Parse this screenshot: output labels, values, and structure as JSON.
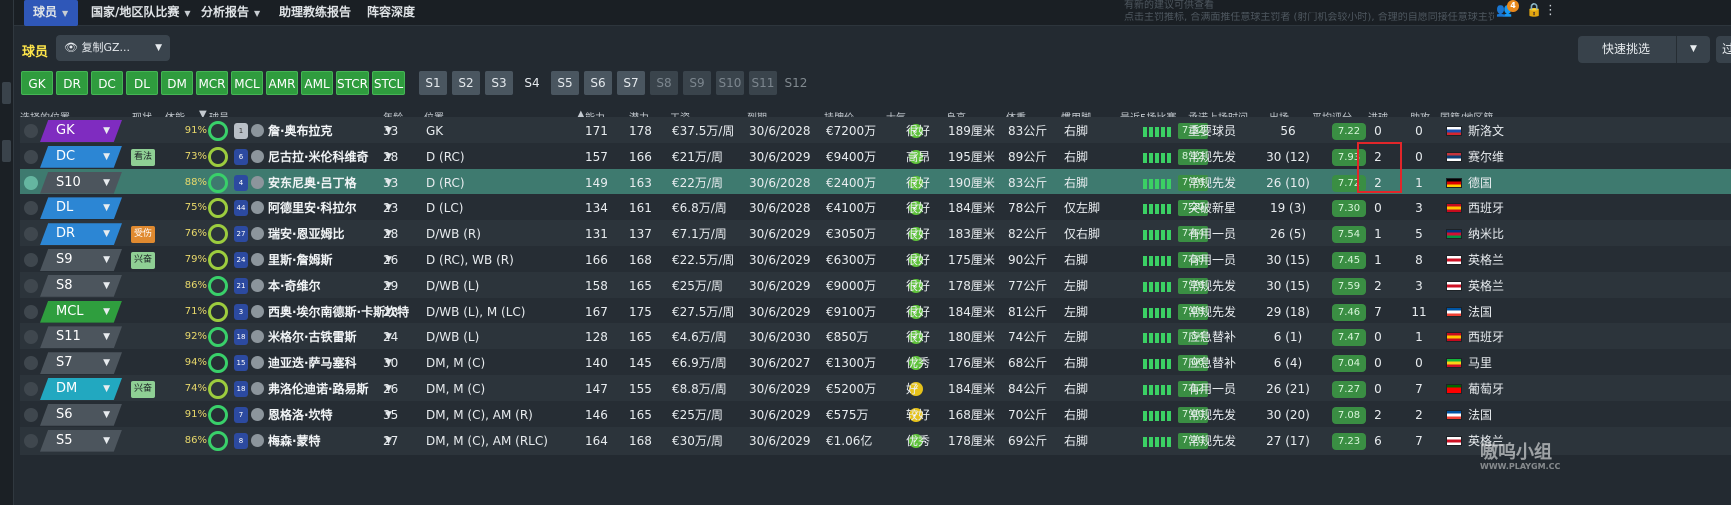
{
  "topnav": {
    "items": [
      {
        "label": "球员",
        "active": true
      },
      {
        "label": "国家/地区队比赛",
        "active": false
      },
      {
        "label": "分析报告",
        "active": false
      },
      {
        "label": "助理教练报告",
        "active": false
      },
      {
        "label": "阵容深度",
        "active": false
      }
    ],
    "hint_line1": "有新的建议可供查看",
    "hint_line2": "点击主罚推标, 合满面推任意球主罚者 (射门机会较小时), 合理的自愿同接任意球主罚者",
    "notification_count": "4"
  },
  "toolbar": {
    "section_title": "球员",
    "view_select": "复制GZ...",
    "quick_pick": "快速挑选",
    "filter": "过滤"
  },
  "position_filters": {
    "green": [
      "GK",
      "DR",
      "DC",
      "DL",
      "DM",
      "MCR",
      "MCL",
      "AMR",
      "AML",
      "STCR",
      "STCL"
    ],
    "subs": [
      "S1",
      "S2",
      "S3",
      "S4",
      "S5",
      "S6",
      "S7",
      "S8",
      "S9",
      "S10",
      "S11",
      "S12"
    ]
  },
  "columns": {
    "sel_position": "选择的位置",
    "status": "现状",
    "fitness": "体能...",
    "player": "球员",
    "age": "年龄",
    "position": "位置",
    "ability": "能力",
    "potential": "潜力",
    "wage": "工资",
    "expires": "到期",
    "value": "挂牌价",
    "morale": "士气",
    "height": "身高",
    "weight": "体重",
    "foot": "惯用脚",
    "last5": "最近5场比赛",
    "role": "承诺上场时间",
    "apps": "出场",
    "avg_rating": "平均评分",
    "goals": "进球",
    "assists": "助攻",
    "nation": "国籍/地区籍"
  },
  "rows": [
    {
      "pos": "GK",
      "pos_type": "GK",
      "tag": "",
      "fit": "91%",
      "ring": "g",
      "shirt": "1",
      "gk": true,
      "name": "詹·奥布拉克",
      "age": "33",
      "position": "GK",
      "ca": "171",
      "pa": "178",
      "wage": "€37.5万/周",
      "expires": "30/6/2028",
      "value": "€7200万",
      "morale": "很好",
      "morale_c": "g",
      "height": "189厘米",
      "weight": "83公斤",
      "foot": "右脚",
      "last": "7.32",
      "role": "重要球员",
      "apps": "56",
      "avg": "7.22",
      "goals": "0",
      "assists": "0",
      "nation": "斯洛文",
      "flag": [
        "#ffffff",
        "#1c4fb0",
        "#d7262d"
      ],
      "form": [
        4,
        4,
        4,
        4,
        4
      ]
    },
    {
      "pos": "DC",
      "pos_type": "D",
      "tag": "看法",
      "tag_c": "green",
      "fit": "73%",
      "ring": "y",
      "shirt": "6",
      "name": "尼古拉·米伦科维奇",
      "age": "28",
      "position": "D (RC)",
      "ca": "157",
      "pa": "166",
      "wage": "€21万/周",
      "expires": "30/6/2029",
      "value": "€9400万",
      "morale": "高昂",
      "morale_c": "g",
      "height": "195厘米",
      "weight": "89公斤",
      "foot": "右脚",
      "last": "8.12",
      "role": "常规先发",
      "apps": "30 (12)",
      "avg": "7.93",
      "goals": "2",
      "assists": "0",
      "nation": "赛尔维",
      "flag": [
        "#c6363c",
        "#0c4076",
        "#ffffff"
      ],
      "form": [
        4,
        4,
        4,
        4,
        4
      ]
    },
    {
      "pos": "S10",
      "pos_type": "sub",
      "tag": "",
      "fit": "88%",
      "ring": "g",
      "shirt": "4",
      "name": "安东尼奥·吕丁格",
      "age": "33",
      "position": "D (RC)",
      "ca": "149",
      "pa": "163",
      "wage": "€22万/周",
      "expires": "30/6/2028",
      "value": "€2400万",
      "morale": "很好",
      "morale_c": "g",
      "height": "190厘米",
      "weight": "83公斤",
      "foot": "右脚",
      "last": "7.76",
      "role": "常规先发",
      "apps": "26 (10)",
      "avg": "7.72",
      "goals": "2",
      "assists": "1",
      "nation": "德国",
      "flag": [
        "#000000",
        "#dd0000",
        "#ffce00"
      ],
      "form": [
        4,
        4,
        4,
        4,
        4
      ],
      "selected": true
    },
    {
      "pos": "DL",
      "pos_type": "D",
      "tag": "",
      "fit": "75%",
      "ring": "y",
      "shirt": "44",
      "name": "阿德里安·科拉尔",
      "age": "23",
      "position": "D (LC)",
      "ca": "134",
      "pa": "161",
      "wage": "€6.8万/周",
      "expires": "30/6/2028",
      "value": "€4100万",
      "morale": "很好",
      "morale_c": "g",
      "height": "184厘米",
      "weight": "78公斤",
      "foot": "仅左脚",
      "last": "7.20",
      "role": "突破新星",
      "apps": "19 (3)",
      "avg": "7.30",
      "goals": "0",
      "assists": "3",
      "nation": "西班牙",
      "flag": [
        "#c60b1e",
        "#ffc400",
        "#c60b1e"
      ],
      "form": [
        4,
        4,
        4,
        4,
        4
      ]
    },
    {
      "pos": "DR",
      "pos_type": "D",
      "tag": "受伤",
      "tag_c": "orange",
      "fit": "76%",
      "ring": "y",
      "shirt": "27",
      "name": "瑞安·恩亚姆比",
      "age": "28",
      "position": "D/WB (R)",
      "ca": "131",
      "pa": "137",
      "wage": "€7.1万/周",
      "expires": "30/6/2029",
      "value": "€3050万",
      "morale": "很好",
      "morale_c": "g",
      "height": "183厘米",
      "weight": "82公斤",
      "foot": "仅右脚",
      "last": "7.44",
      "role": "有用一员",
      "apps": "26 (5)",
      "avg": "7.54",
      "goals": "1",
      "assists": "5",
      "nation": "纳米比",
      "flag": [
        "#003580",
        "#d21034",
        "#009543"
      ],
      "form": [
        4,
        4,
        4,
        4,
        4
      ]
    },
    {
      "pos": "S9",
      "pos_type": "sub",
      "tag": "兴奋",
      "tag_c": "green",
      "fit": "79%",
      "ring": "y",
      "shirt": "24",
      "name": "里斯·詹姆斯",
      "age": "26",
      "position": "D (RC), WB (R)",
      "ca": "166",
      "pa": "168",
      "wage": "€22.5万/周",
      "expires": "30/6/2029",
      "value": "€6300万",
      "morale": "很好",
      "morale_c": "g",
      "height": "175厘米",
      "weight": "90公斤",
      "foot": "右脚",
      "last": "7.38",
      "role": "有用一员",
      "apps": "30 (15)",
      "avg": "7.45",
      "goals": "1",
      "assists": "8",
      "nation": "英格兰",
      "flag": [
        "#ffffff",
        "#ce1124",
        "#ffffff"
      ],
      "form": [
        4,
        4,
        4,
        4,
        4
      ]
    },
    {
      "pos": "S8",
      "pos_type": "sub",
      "tag": "",
      "fit": "86%",
      "ring": "g",
      "shirt": "21",
      "name": "本·奇维尔",
      "age": "29",
      "position": "D/WB (L)",
      "ca": "158",
      "pa": "165",
      "wage": "€25万/周",
      "expires": "30/6/2029",
      "value": "€9000万",
      "morale": "很好",
      "morale_c": "g",
      "height": "178厘米",
      "weight": "77公斤",
      "foot": "左脚",
      "last": "7.76",
      "role": "常规先发",
      "apps": "30 (15)",
      "avg": "7.59",
      "goals": "2",
      "assists": "3",
      "nation": "英格兰",
      "flag": [
        "#ffffff",
        "#ce1124",
        "#ffffff"
      ],
      "form": [
        4,
        4,
        4,
        4,
        4
      ]
    },
    {
      "pos": "MCL",
      "pos_type": "M",
      "tag": "",
      "fit": "71%",
      "ring": "y",
      "shirt": "3",
      "name": "西奥·埃尔南德斯·卡斯坎特",
      "age": "28",
      "position": "D/WB (L), M (LC)",
      "ca": "167",
      "pa": "175",
      "wage": "€27.5万/周",
      "expires": "30/6/2029",
      "value": "€9100万",
      "morale": "很好",
      "morale_c": "g",
      "height": "184厘米",
      "weight": "81公斤",
      "foot": "左脚",
      "last": "7.08",
      "role": "常规先发",
      "apps": "29 (18)",
      "avg": "7.46",
      "goals": "7",
      "assists": "11",
      "nation": "法国",
      "flag": [
        "#0055a4",
        "#ffffff",
        "#ef4135"
      ],
      "form": [
        4,
        4,
        4,
        4,
        4
      ]
    },
    {
      "pos": "S11",
      "pos_type": "sub",
      "tag": "",
      "fit": "92%",
      "ring": "g",
      "shirt": "18",
      "name": "米格尔·古铁雷斯",
      "age": "24",
      "position": "D/WB (L)",
      "ca": "128",
      "pa": "165",
      "wage": "€4.6万/周",
      "expires": "30/6/2030",
      "value": "€850万",
      "morale": "很好",
      "morale_c": "g",
      "height": "180厘米",
      "weight": "74公斤",
      "foot": "左脚",
      "last": "7.54",
      "role": "应急替补",
      "apps": "6 (1)",
      "avg": "7.47",
      "goals": "0",
      "assists": "1",
      "nation": "西班牙",
      "flag": [
        "#c60b1e",
        "#ffc400",
        "#c60b1e"
      ],
      "form": [
        4,
        4,
        4,
        4,
        4
      ]
    },
    {
      "pos": "S7",
      "pos_type": "sub",
      "tag": "",
      "fit": "94%",
      "ring": "g",
      "shirt": "15",
      "name": "迪亚迭·萨马塞科",
      "age": "30",
      "position": "DM, M (C)",
      "ca": "140",
      "pa": "145",
      "wage": "€6.9万/周",
      "expires": "30/6/2027",
      "value": "€1300万",
      "morale": "优秀",
      "morale_c": "g",
      "height": "176厘米",
      "weight": "68公斤",
      "foot": "右脚",
      "last": "7.06",
      "role": "应急替补",
      "apps": "6 (4)",
      "avg": "7.04",
      "goals": "0",
      "assists": "0",
      "nation": "马里",
      "flag": [
        "#14b53a",
        "#fcd116",
        "#ce1126"
      ],
      "form": [
        4,
        4,
        4,
        4,
        4
      ]
    },
    {
      "pos": "DM",
      "pos_type": "DM",
      "tag": "兴奋",
      "tag_c": "green",
      "fit": "74%",
      "ring": "y",
      "shirt": "18",
      "name": "弗洛伦迪诺·路易斯",
      "age": "26",
      "position": "DM, M (C)",
      "ca": "147",
      "pa": "155",
      "wage": "€8.8万/周",
      "expires": "30/6/2029",
      "value": "€5200万",
      "morale": "好",
      "morale_c": "y",
      "height": "184厘米",
      "weight": "84公斤",
      "foot": "右脚",
      "last": "7.12",
      "role": "有用一员",
      "apps": "26 (21)",
      "avg": "7.27",
      "goals": "0",
      "assists": "7",
      "nation": "葡萄牙",
      "flag": [
        "#006600",
        "#ff0000",
        "#ff0000"
      ],
      "form": [
        4,
        4,
        4,
        4,
        4
      ]
    },
    {
      "pos": "S6",
      "pos_type": "sub",
      "tag": "",
      "fit": "91%",
      "ring": "g",
      "shirt": "7",
      "name": "恩格洛·坎特",
      "age": "35",
      "position": "DM, M (C), AM (R)",
      "ca": "146",
      "pa": "165",
      "wage": "€25万/周",
      "expires": "30/6/2029",
      "value": "€575万",
      "morale": "较好",
      "morale_c": "y",
      "height": "168厘米",
      "weight": "70公斤",
      "foot": "右脚",
      "last": "7.00",
      "role": "常规先发",
      "apps": "30 (20)",
      "avg": "7.08",
      "goals": "2",
      "assists": "2",
      "nation": "法国",
      "flag": [
        "#0055a4",
        "#ffffff",
        "#ef4135"
      ],
      "form": [
        4,
        4,
        4,
        4,
        4
      ]
    },
    {
      "pos": "S5",
      "pos_type": "sub",
      "tag": "",
      "fit": "86%",
      "ring": "g",
      "shirt": "8",
      "name": "梅森·蒙特",
      "age": "27",
      "position": "DM, M (C), AM (RLC)",
      "ca": "164",
      "pa": "168",
      "wage": "€30万/周",
      "expires": "30/6/2029",
      "value": "€1.06亿",
      "morale": "优秀",
      "morale_c": "g",
      "height": "178厘米",
      "weight": "69公斤",
      "foot": "右脚",
      "last": "7.20",
      "role": "常规先发",
      "apps": "27 (17)",
      "avg": "7.23",
      "goals": "6",
      "assists": "7",
      "nation": "英格兰",
      "flag": [
        "#ffffff",
        "#ce1124",
        "#ffffff"
      ],
      "form": [
        4,
        4,
        4,
        4,
        4
      ]
    }
  ],
  "watermark": {
    "text": "嗷呜小组",
    "sub": "WWW.PLAYGM.CC"
  }
}
